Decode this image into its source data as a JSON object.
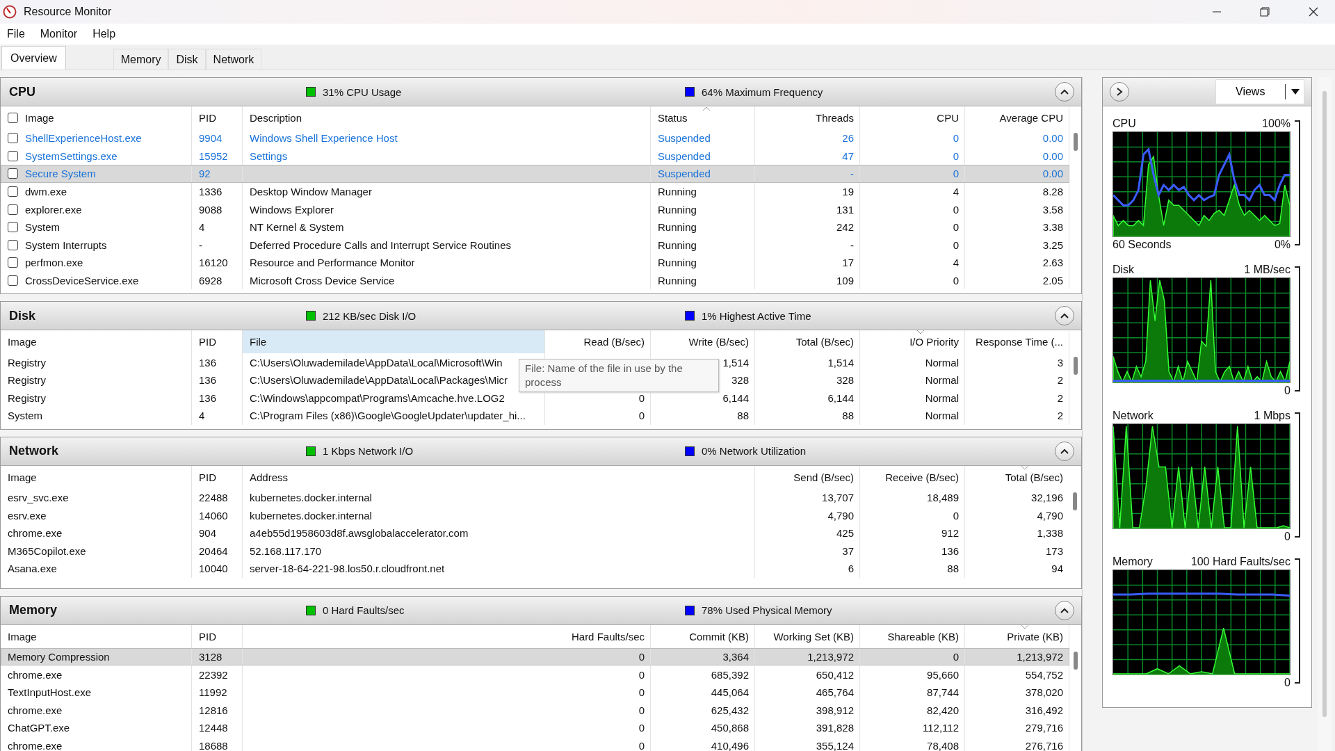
{
  "window": {
    "title": "Resource Monitor"
  },
  "menu": [
    "File",
    "Monitor",
    "Help"
  ],
  "tabs": [
    {
      "label": "Overview",
      "selected": true
    },
    {
      "label": "Memory",
      "selected": false
    },
    {
      "label": "Disk",
      "selected": false
    },
    {
      "label": "Network",
      "selected": false
    }
  ],
  "sections": [
    {
      "kind": "cpu",
      "title": "CPU",
      "expanded": true,
      "stats": [
        {
          "text": "31% CPU Usage",
          "color": "#00c000"
        },
        {
          "text": "64% Maximum Frequency",
          "color": "#0000ff"
        }
      ],
      "columns": [
        {
          "label": "Image",
          "highlighted": false
        },
        {
          "label": "PID",
          "highlighted": false
        },
        {
          "label": "Description",
          "highlighted": false
        },
        {
          "label": "Status",
          "highlighted": false,
          "sorted": true,
          "ascending": true
        },
        {
          "label": "Threads",
          "highlighted": false
        },
        {
          "label": "CPU",
          "highlighted": false
        },
        {
          "label": "Average CPU",
          "highlighted": false
        }
      ],
      "header_checked": false,
      "rows": [
        {
          "checked": false,
          "suspended": true,
          "selected": false,
          "cells": [
            "ShellExperienceHost.exe",
            "9904",
            "Windows Shell Experience Host",
            "Suspended",
            "26",
            "0",
            "0.00"
          ]
        },
        {
          "checked": false,
          "suspended": true,
          "selected": false,
          "cells": [
            "SystemSettings.exe",
            "15952",
            "Settings",
            "Suspended",
            "47",
            "0",
            "0.00"
          ]
        },
        {
          "checked": false,
          "suspended": true,
          "selected": true,
          "cells": [
            "Secure System",
            "92",
            null,
            "Suspended",
            "-",
            "0",
            "0.00"
          ]
        },
        {
          "checked": false,
          "suspended": false,
          "selected": false,
          "cells": [
            "dwm.exe",
            "1336",
            "Desktop Window Manager",
            "Running",
            "19",
            "4",
            "8.28"
          ]
        },
        {
          "checked": false,
          "suspended": false,
          "selected": false,
          "cells": [
            "explorer.exe",
            "9088",
            "Windows Explorer",
            "Running",
            "131",
            "0",
            "3.58"
          ]
        },
        {
          "checked": false,
          "suspended": false,
          "selected": false,
          "cells": [
            "System",
            "4",
            "NT Kernel & System",
            "Running",
            "242",
            "0",
            "3.38"
          ]
        },
        {
          "checked": false,
          "suspended": false,
          "selected": false,
          "cells": [
            "System Interrupts",
            "-",
            "Deferred Procedure Calls and Interrupt Service Routines",
            "Running",
            "-",
            "0",
            "3.25"
          ]
        },
        {
          "checked": false,
          "suspended": false,
          "selected": false,
          "cells": [
            "perfmon.exe",
            "16120",
            "Resource and Performance Monitor",
            "Running",
            "17",
            "4",
            "2.63"
          ]
        },
        {
          "checked": false,
          "suspended": false,
          "selected": false,
          "cells": [
            "CrossDeviceService.exe",
            "6928",
            "Microsoft Cross Device Service",
            "Running",
            "109",
            "0",
            "2.05"
          ]
        }
      ]
    },
    {
      "kind": "disk",
      "title": "Disk",
      "expanded": true,
      "stats": [
        {
          "text": "212 KB/sec Disk I/O",
          "color": "#00c000"
        },
        {
          "text": "1% Highest Active Time",
          "color": "#0000ff"
        }
      ],
      "columns": [
        {
          "label": "Image",
          "highlighted": false
        },
        {
          "label": "PID",
          "highlighted": false
        },
        {
          "label": "File",
          "highlighted": true
        },
        {
          "label": "Read (B/sec)",
          "highlighted": false
        },
        {
          "label": "Write (B/sec)",
          "highlighted": false
        },
        {
          "label": "Total (B/sec)",
          "highlighted": false
        },
        {
          "label": "I/O Priority",
          "highlighted": false,
          "sorted": true,
          "ascending": false
        },
        {
          "label": "Response Time (...",
          "highlighted": false
        }
      ],
      "tooltip": "File: Name of the file in use by the process",
      "rows": [
        {
          "selected": false,
          "cells": [
            "Registry",
            "136",
            "C:\\Users\\Oluwademilade\\AppData\\Local\\Microsoft\\Win",
            null,
            "1,514",
            "1,514",
            "Normal",
            "3"
          ]
        },
        {
          "selected": false,
          "cells": [
            "Registry",
            "136",
            "C:\\Users\\Oluwademilade\\AppData\\Local\\Packages\\Micr",
            null,
            "328",
            "328",
            "Normal",
            "2"
          ]
        },
        {
          "selected": false,
          "cells": [
            "Registry",
            "136",
            "C:\\Windows\\appcompat\\Programs\\Amcache.hve.LOG2",
            "0",
            "6,144",
            "6,144",
            "Normal",
            "2"
          ]
        },
        {
          "selected": false,
          "cells": [
            "System",
            "4",
            "C:\\Program Files (x86)\\Google\\GoogleUpdater\\updater_hi...",
            "0",
            "88",
            "88",
            "Normal",
            "2"
          ]
        }
      ]
    },
    {
      "kind": "network",
      "title": "Network",
      "expanded": true,
      "stats": [
        {
          "text": "1 Kbps Network I/O",
          "color": "#00c000"
        },
        {
          "text": "0% Network Utilization",
          "color": "#0000ff"
        }
      ],
      "columns": [
        {
          "label": "Image",
          "highlighted": false
        },
        {
          "label": "PID",
          "highlighted": false
        },
        {
          "label": "Address",
          "highlighted": false
        },
        {
          "label": "Send (B/sec)",
          "highlighted": false
        },
        {
          "label": "Receive (B/sec)",
          "highlighted": false
        },
        {
          "label": "Total (B/sec)",
          "highlighted": false,
          "sorted": true,
          "ascending": false
        }
      ],
      "rows": [
        {
          "selected": false,
          "cells": [
            "esrv_svc.exe",
            "22488",
            "kubernetes.docker.internal",
            "13,707",
            "18,489",
            "32,196"
          ]
        },
        {
          "selected": false,
          "cells": [
            "esrv.exe",
            "14060",
            "kubernetes.docker.internal",
            "4,790",
            "0",
            "4,790"
          ]
        },
        {
          "selected": false,
          "cells": [
            "chrome.exe",
            "904",
            "a4eb55d1958603d8f.awsglobalaccelerator.com",
            "425",
            "912",
            "1,338"
          ]
        },
        {
          "selected": false,
          "cells": [
            "M365Copilot.exe",
            "20464",
            "52.168.117.170",
            "37",
            "136",
            "173"
          ]
        },
        {
          "selected": false,
          "cells": [
            "Asana.exe",
            "10040",
            "server-18-64-221-98.los50.r.cloudfront.net",
            "6",
            "88",
            "94"
          ]
        }
      ]
    },
    {
      "kind": "memory",
      "title": "Memory",
      "expanded": true,
      "stats": [
        {
          "text": "0 Hard Faults/sec",
          "color": "#00c000"
        },
        {
          "text": "78% Used Physical Memory",
          "color": "#0000ff"
        }
      ],
      "columns": [
        {
          "label": "Image",
          "highlighted": false
        },
        {
          "label": "PID",
          "highlighted": false
        },
        {
          "label": "Hard Faults/sec",
          "highlighted": false
        },
        {
          "label": "Commit (KB)",
          "highlighted": false
        },
        {
          "label": "Working Set (KB)",
          "highlighted": false
        },
        {
          "label": "Shareable (KB)",
          "highlighted": false
        },
        {
          "label": "Private (KB)",
          "highlighted": false,
          "sorted": true,
          "ascending": false
        }
      ],
      "rows": [
        {
          "selected": true,
          "cells": [
            "Memory Compression",
            "3128",
            "0",
            "3,364",
            "1,213,972",
            "0",
            "1,213,972"
          ]
        },
        {
          "selected": false,
          "cells": [
            "chrome.exe",
            "22392",
            "0",
            "685,392",
            "650,412",
            "95,660",
            "554,752"
          ]
        },
        {
          "selected": false,
          "cells": [
            "TextInputHost.exe",
            "11992",
            "0",
            "445,064",
            "465,764",
            "87,744",
            "378,020"
          ]
        },
        {
          "selected": false,
          "cells": [
            "chrome.exe",
            "12816",
            "0",
            "625,432",
            "398,912",
            "82,420",
            "316,492"
          ]
        },
        {
          "selected": false,
          "cells": [
            "ChatGPT.exe",
            "12448",
            "0",
            "450,868",
            "391,828",
            "112,112",
            "279,716"
          ]
        },
        {
          "selected": false,
          "cells": [
            "chrome.exe",
            "18688",
            "0",
            "410,496",
            "355,124",
            "78,408",
            "276,716"
          ]
        }
      ]
    }
  ],
  "side": {
    "views_label": "Views",
    "graphs": [
      {
        "kind": "cpu",
        "title": "CPU",
        "max_label": "100%",
        "footer_left": "60 Seconds",
        "min_label": "0%"
      },
      {
        "kind": "disk",
        "title": "Disk",
        "max_label": "1 MB/sec",
        "min_label": "0"
      },
      {
        "kind": "network",
        "title": "Network",
        "max_label": "1 Mbps",
        "min_label": "0"
      },
      {
        "kind": "memory",
        "title": "Memory",
        "max_label": "100 Hard Faults/sec",
        "min_label": "0"
      }
    ]
  }
}
